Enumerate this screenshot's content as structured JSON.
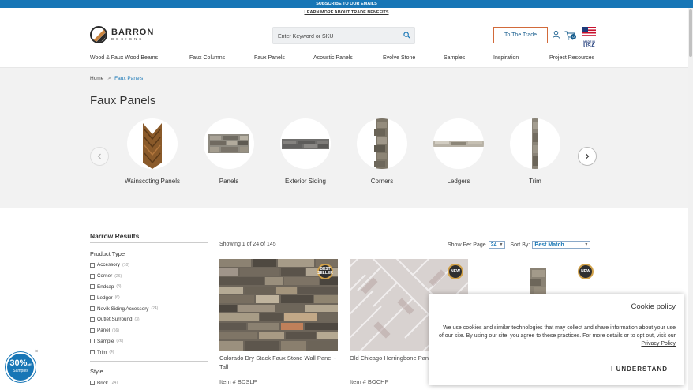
{
  "promo": {
    "subscribe": "SUBSCRIBE TO OUR EMAILS",
    "trade_benefits": "LEARN MORE ABOUT TRADE BENEFITS"
  },
  "header": {
    "logo_name": "BARRON",
    "logo_sub": "DESIGNS",
    "search_placeholder": "Enter Keyword or SKU",
    "trade_button": "To The Trade",
    "cart_count": "0",
    "usa_badge": [
      "MADE IN",
      "USA"
    ]
  },
  "nav": {
    "items": [
      "Wood & Faux Wood Beams",
      "Faux Columns",
      "Faux Panels",
      "Acoustic Panels",
      "Evolve Stone",
      "Samples",
      "Inspiration",
      "Project Resources"
    ]
  },
  "breadcrumb": {
    "home": "Home",
    "separator": ">",
    "current": "Faux Panels"
  },
  "page_title": "Faux Panels",
  "categories": [
    "Wainscoting Panels",
    "Panels",
    "Exterior Siding",
    "Corners",
    "Ledgers",
    "Trim"
  ],
  "sidebar": {
    "title": "Narrow Results",
    "product_type_title": "Product Type",
    "product_types": [
      {
        "label": "Accessory",
        "count": "(10)"
      },
      {
        "label": "Corner",
        "count": "(26)"
      },
      {
        "label": "Endcap",
        "count": "(8)"
      },
      {
        "label": "Ledger",
        "count": "(6)"
      },
      {
        "label": "Novik Siding Accessory",
        "count": "(24)"
      },
      {
        "label": "Outlet Surround",
        "count": "(3)"
      },
      {
        "label": "Panel",
        "count": "(56)"
      },
      {
        "label": "Sample",
        "count": "(26)"
      },
      {
        "label": "Trim",
        "count": "(4)"
      }
    ],
    "style_title": "Style",
    "styles": [
      {
        "label": "Brick",
        "count": "(24)"
      }
    ]
  },
  "results": {
    "showing": "Showing 1 of 24 of 145",
    "per_page_label": "Show Per Page",
    "per_page_value": "24",
    "sort_label": "Sort By:",
    "sort_value": "Best Match"
  },
  "products": [
    {
      "name": "Colorado Dry Stack Faux Stone Wall Panel - Tall",
      "item": "Item # BDSLP",
      "badge": "BEST SELLER"
    },
    {
      "name": "Old Chicago Herringbone Panel",
      "item": "Item # BOCHP",
      "badge": "NEW"
    },
    {
      "name": "",
      "item": "",
      "badge": "NEW"
    }
  ],
  "cookie": {
    "title": "Cookie policy",
    "text": "We use cookies and similar technologies that may collect and share information about your use of our site. By using our site, you agree to these practices. For more details or to opt out, visit our",
    "link": "Privacy Policy",
    "button": "I UNDERSTAND"
  },
  "samples_badge": {
    "percent": "30%",
    "off": "off",
    "label": "Samples",
    "close": "×"
  },
  "colors": {
    "brand_blue": "#1776b6",
    "accent_orange": "#d26a3a",
    "hero_bg": "#f2f2f2"
  }
}
